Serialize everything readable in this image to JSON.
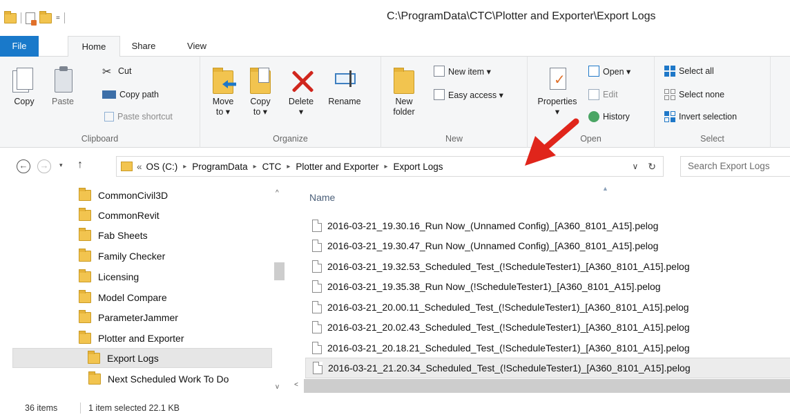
{
  "window": {
    "title": "C:\\ProgramData\\CTC\\Plotter and Exporter\\Export Logs"
  },
  "qat": {
    "arrow": "="
  },
  "tabs": {
    "file": "File",
    "home": "Home",
    "share": "Share",
    "view": "View"
  },
  "ribbon": {
    "clipboard": {
      "label": "Clipboard",
      "copy": "Copy",
      "paste": "Paste",
      "cut": "Cut",
      "copy_path": "Copy path",
      "paste_shortcut": "Paste shortcut"
    },
    "organize": {
      "label": "Organize",
      "move_to_1": "Move",
      "move_to_2": "to ▾",
      "copy_to_1": "Copy",
      "copy_to_2": "to ▾",
      "delete": "Delete",
      "delete_arrow": "▾",
      "rename": "Rename"
    },
    "new": {
      "label": "New",
      "new_folder_1": "New",
      "new_folder_2": "folder",
      "new_item": "New item ▾",
      "easy_access": "Easy access ▾"
    },
    "open": {
      "label": "Open",
      "properties": "Properties",
      "properties_arrow": "▾",
      "open": "Open ▾",
      "edit": "Edit",
      "history": "History"
    },
    "select": {
      "label": "Select",
      "select_all": "Select all",
      "select_none": "Select none",
      "invert_selection": "Invert selection"
    }
  },
  "navigation": {
    "back": "←",
    "forward": "→",
    "recent": "▾",
    "up": "↑",
    "overflow": "«",
    "breadcrumb": [
      "OS (C:)",
      "ProgramData",
      "CTC",
      "Plotter and Exporter",
      "Export Logs"
    ],
    "separator": "▸",
    "dropdown": "∨",
    "refresh": "↻",
    "search_placeholder": "Search Export Logs"
  },
  "nav_pane": {
    "items": [
      "CommonCivil3D",
      "CommonRevit",
      "Fab Sheets",
      "Family Checker",
      "Licensing",
      "Model Compare",
      "ParameterJammer",
      "Plotter and Exporter",
      "Export Logs",
      "Next Scheduled Work To Do"
    ],
    "selected": "Export Logs",
    "scroll_up": "^",
    "scroll_down": "v",
    "scroll_left": "<"
  },
  "file_list": {
    "column_name": "Name",
    "sort_indicator": "▲",
    "files": [
      "2016-03-21_19.30.16_Run Now_(Unnamed Config)_[A360_8101_A15].pelog",
      "2016-03-21_19.30.47_Run Now_(Unnamed Config)_[A360_8101_A15].pelog",
      "2016-03-21_19.32.53_Scheduled_Test_(!ScheduleTester1)_[A360_8101_A15].pelog",
      "2016-03-21_19.35.38_Run Now_(!ScheduleTester1)_[A360_8101_A15].pelog",
      "2016-03-21_20.00.11_Scheduled_Test_(!ScheduleTester1)_[A360_8101_A15].pelog",
      "2016-03-21_20.02.43_Scheduled_Test_(!ScheduleTester1)_[A360_8101_A15].pelog",
      "2016-03-21_20.18.21_Scheduled_Test_(!ScheduleTester1)_[A360_8101_A15].pelog",
      "2016-03-21_21.20.34_Scheduled_Test_(!ScheduleTester1)_[A360_8101_A15].pelog"
    ],
    "selected_index": 7
  },
  "status": {
    "item_count": "36 items",
    "selection": "1 item selected  22.1 KB"
  },
  "colors": {
    "file_tab": "#1979ca",
    "folder": "#f2c44f",
    "annotation_arrow": "#e0251b",
    "delete_red": "#d0261d"
  }
}
